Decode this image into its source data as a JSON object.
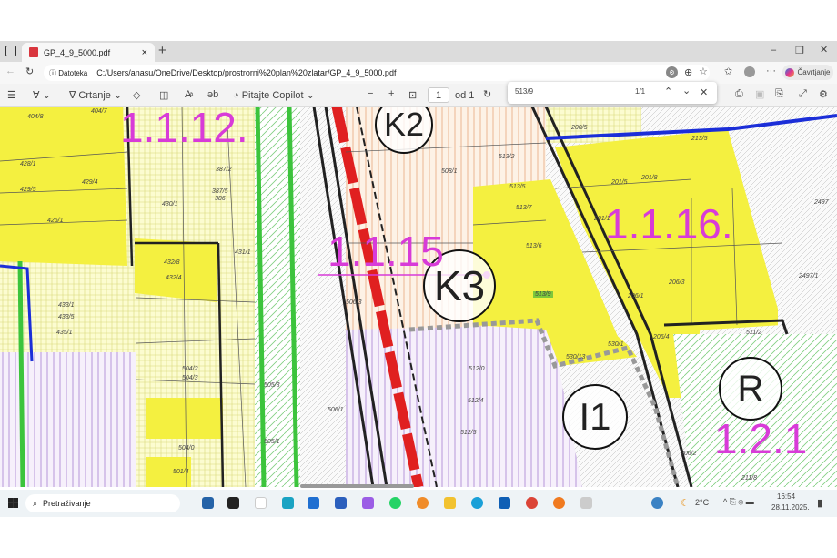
{
  "browser": {
    "tab_title": "GP_4_9_5000.pdf",
    "new_tab": "+",
    "address_label": "Datoteka",
    "url": "C:/Users/anasu/OneDrive/Desktop/prostrorni%20plan%20zlatar/GP_4_9_5000.pdf",
    "chat_label": "Čavrtjanje"
  },
  "pdf_toolbar": {
    "draw_label": "Crtanje",
    "copilot_label": "Pitajte Copilot",
    "page_current": "1",
    "page_total": "od 1"
  },
  "find_bar": {
    "query": "513/9",
    "result": "1/1"
  },
  "map": {
    "zones": [
      "1.1.12.",
      "1.1.15",
      "1.1.16.",
      "1.2.1"
    ],
    "circles": [
      "K2",
      "K3",
      "R",
      "I1"
    ],
    "parcels": [
      "404/8",
      "404/7",
      "428/1",
      "429/4",
      "429/5",
      "426/1",
      "430/1",
      "387/2",
      "387/5",
      "386",
      "431/1",
      "432/8",
      "432/4",
      "433/1",
      "433/5",
      "435/1",
      "504/2",
      "504/3",
      "504/0",
      "505/1",
      "505/3",
      "506/1",
      "506/3",
      "508/1",
      "513/2",
      "513/5",
      "513/7",
      "513/6",
      "513/9",
      "530/13",
      "530/1",
      "512/4",
      "512/5",
      "201/1",
      "201/5",
      "201/8",
      "206/1",
      "206/3",
      "206/4",
      "213/5",
      "2497",
      "2497/1",
      "511/2",
      "211/8",
      "206/2",
      "501/4",
      "200/5",
      "512/0"
    ]
  },
  "taskbar": {
    "search_placeholder": "Pretraživanje",
    "weather": "2°C",
    "time": "16:54",
    "date": "28.11.2025."
  }
}
